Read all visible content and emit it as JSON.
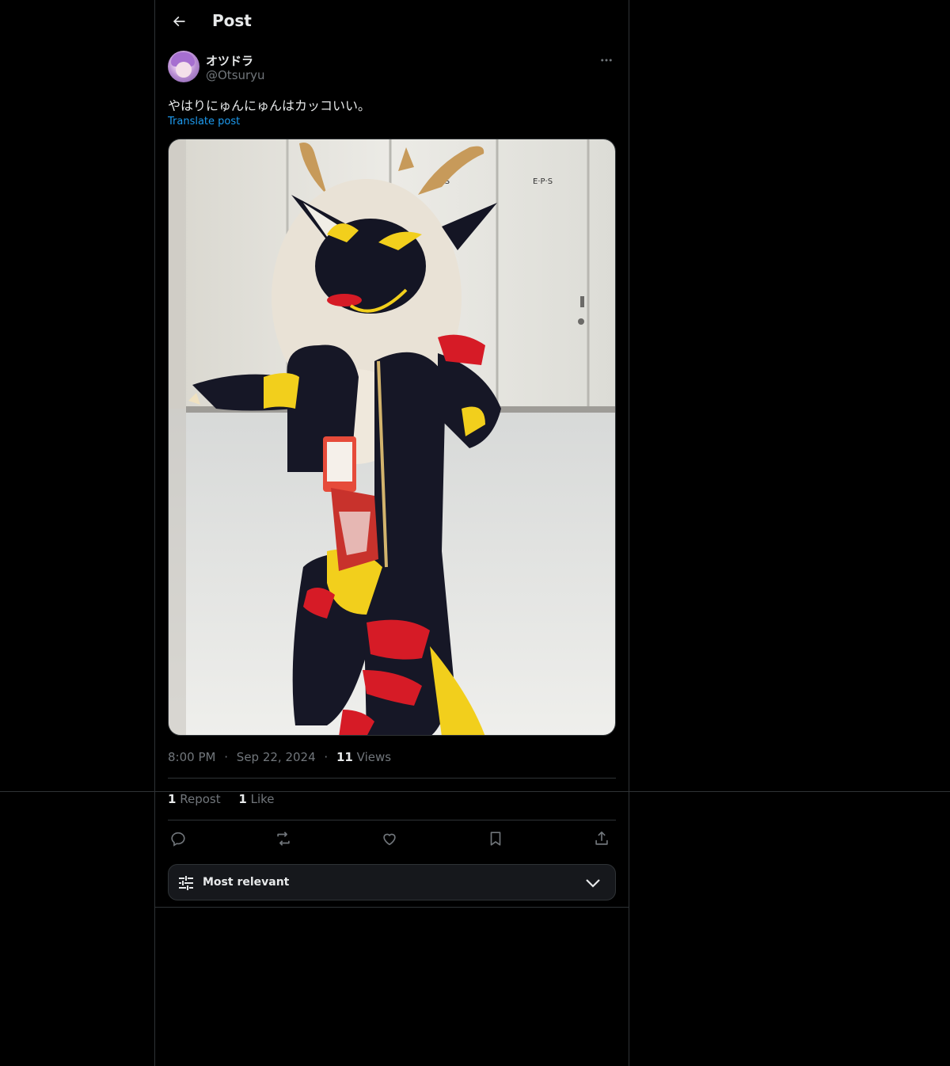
{
  "header": {
    "title": "Post"
  },
  "author": {
    "display_name": "オツドラ",
    "handle": "@Otsuryu"
  },
  "post": {
    "text": "やはりにゅんにゅんはカッコいい。",
    "translate_label": "Translate post"
  },
  "media": {
    "sign_left": "E·P·S",
    "sign_right": "E·P·S"
  },
  "meta": {
    "time": "8:00 PM",
    "date": "Sep 22, 2024",
    "views_count": "11",
    "views_label": "Views",
    "separator": "·"
  },
  "stats": {
    "reposts_count": "1",
    "reposts_label": "Repost",
    "likes_count": "1",
    "likes_label": "Like"
  },
  "sort": {
    "label": "Most relevant"
  },
  "icons": {
    "back": "arrow-left-icon",
    "more": "more-horizontal-icon",
    "reply": "reply-icon",
    "repost": "repost-icon",
    "like": "heart-icon",
    "bookmark": "bookmark-icon",
    "share": "share-icon",
    "sort": "sliders-icon",
    "chevron": "chevron-down-icon"
  },
  "colors": {
    "background": "#000000",
    "link": "#1d9bf0",
    "muted": "#71767b",
    "border": "#2f3336"
  }
}
